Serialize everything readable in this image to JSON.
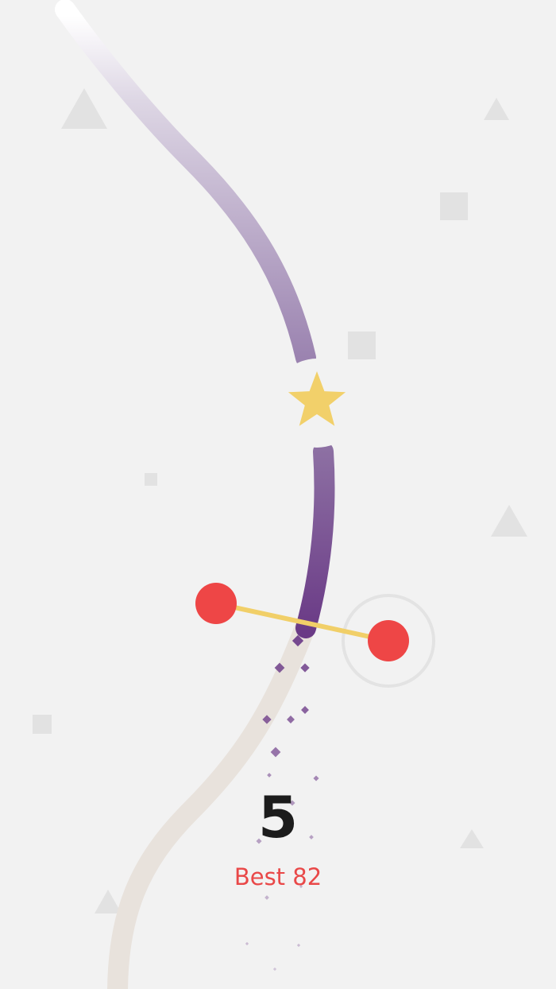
{
  "score": "5",
  "best": {
    "label": "Best",
    "value": "82"
  },
  "colors": {
    "background": "#f2f2f2",
    "path_upcoming": "#6f3f8a",
    "path_traveled": "#e8e2dc",
    "player_ball": "#ee4646",
    "player_bar": "#f1cf68",
    "star": "#f2d06a",
    "score_text": "#1c1c1c",
    "best_text": "#e94848",
    "decor_shape": "#e2e2e2",
    "target_ring": "#e3e3e3"
  },
  "icons": {
    "collectible": "star-icon",
    "background_shapes": [
      "triangle-icon",
      "square-icon"
    ]
  }
}
